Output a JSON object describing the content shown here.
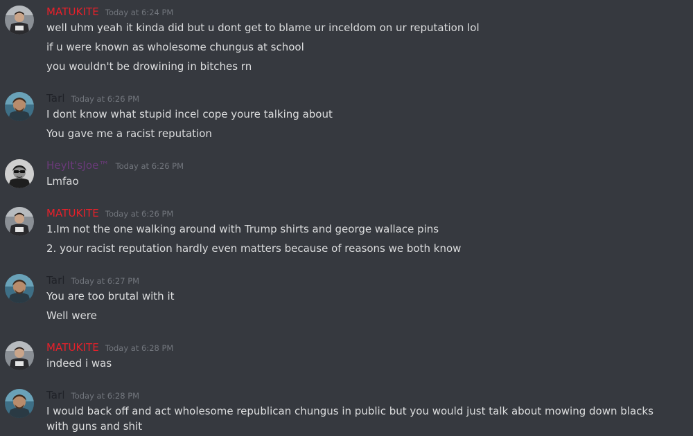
{
  "colors": {
    "background": "#36393f",
    "text": "#dcddde",
    "timestamp": "#72767d",
    "matukite": "#e8202a",
    "tarl": "#1f2127",
    "heyitsjoe": "#6b3a7a"
  },
  "messages": [
    {
      "author": "MATUKITE",
      "timestamp": "Today at 6:24 PM",
      "avatar": "matukite-avatar",
      "lines": [
        "well uhm yeah it kinda did but u dont get to blame ur inceldom on ur reputation lol",
        "if u were known as wholesome chungus at school",
        "you wouldn't be drowining in bitches rn"
      ]
    },
    {
      "author": "Tarl",
      "timestamp": "Today at 6:26 PM",
      "avatar": "tarl-avatar",
      "lines": [
        "I dont know what stupid incel cope youre talking about",
        "You gave me a racist reputation"
      ]
    },
    {
      "author": "HeyIt'sJoe™",
      "timestamp": "Today at 6:26 PM",
      "avatar": "heyitsjoe-avatar",
      "lines": [
        "Lmfao"
      ]
    },
    {
      "author": "MATUKITE",
      "timestamp": "Today at 6:26 PM",
      "avatar": "matukite-avatar",
      "lines": [
        "1.Im not the one walking around with Trump shirts and george wallace pins",
        "2. your racist reputation hardly even matters because of reasons we both know"
      ]
    },
    {
      "author": "Tarl",
      "timestamp": "Today at 6:27 PM",
      "avatar": "tarl-avatar",
      "lines": [
        "You are too brutal with it",
        "Well were"
      ]
    },
    {
      "author": "MATUKITE",
      "timestamp": "Today at 6:28 PM",
      "avatar": "matukite-avatar",
      "lines": [
        "indeed i was"
      ]
    },
    {
      "author": "Tarl",
      "timestamp": "Today at 6:28 PM",
      "avatar": "tarl-avatar",
      "lines": [
        "I would back off and act wholesome republican chungus in public but you would just talk about mowing down blacks with guns and shit"
      ]
    }
  ]
}
